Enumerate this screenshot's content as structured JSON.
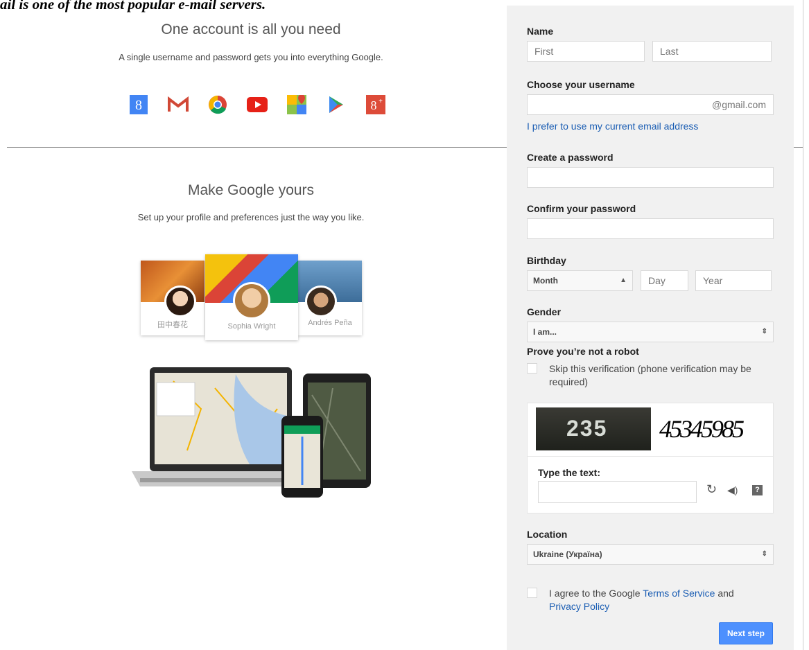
{
  "page": {
    "top_caption": "ail is one of the most popular e-mail servers."
  },
  "left": {
    "section1": {
      "title": "One account is all you need",
      "subtitle": "A single username and password gets you into everything Google."
    },
    "app_icons": [
      "google-search-icon",
      "gmail-icon",
      "chrome-icon",
      "youtube-icon",
      "maps-icon",
      "play-icon",
      "google-plus-icon"
    ],
    "section2": {
      "title": "Make Google yours",
      "subtitle": "Set up your profile and preferences just the way you like."
    },
    "profiles": [
      {
        "name": "田中春花"
      },
      {
        "name": "Sophia Wright"
      },
      {
        "name": "Andrés Peña"
      }
    ]
  },
  "form": {
    "name_label": "Name",
    "first_placeholder": "First",
    "last_placeholder": "Last",
    "username_label": "Choose your username",
    "username_suffix": "@gmail.com",
    "prefer_email_link": "I prefer to use my current email address",
    "password_label": "Create a password",
    "confirm_label": "Confirm your password",
    "birthday_label": "Birthday",
    "month_value": "Month",
    "day_placeholder": "Day",
    "year_placeholder": "Year",
    "gender_label": "Gender",
    "gender_value": "I am...",
    "robot_label": "Prove you’re not a robot",
    "skip_verification_line1": "Skip this verification (phone verification may be",
    "skip_verification_line2": "required)",
    "captcha_left": "235",
    "captcha_right": "45345985",
    "type_text_label": "Type the text:",
    "location_label": "Location",
    "location_value": "Ukraine (Україна)",
    "terms_prefix": "I agree to the Google ",
    "terms_link": "Terms of Service",
    "terms_and": " and",
    "privacy_link": "Privacy Policy",
    "next_button": "Next step"
  },
  "colors": {
    "panel_bg": "#f1f1f1",
    "link": "#1a5db3",
    "button": "#4d90fe"
  }
}
